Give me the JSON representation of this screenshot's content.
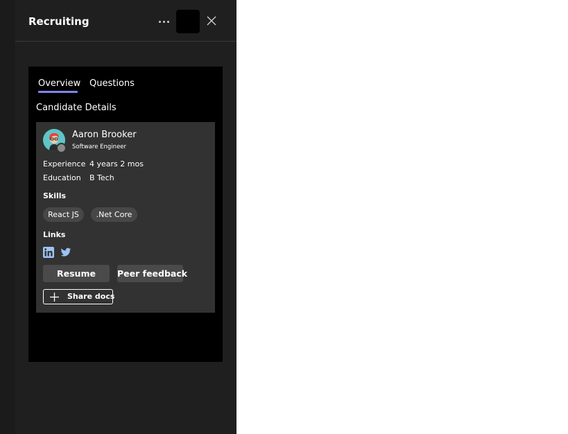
{
  "header": {
    "title": "Recruiting",
    "more_icon": "more-horizontal-icon",
    "close_icon": "close-icon"
  },
  "tabs": [
    {
      "label": "Overview",
      "selected": true
    },
    {
      "label": "Questions",
      "selected": false
    }
  ],
  "section_title": "Candidate Details",
  "candidate": {
    "name": "Aaron Brooker",
    "role": "Software Engineer",
    "presence": "offline",
    "details": [
      {
        "label": "Experience",
        "value": "4 years 2 mos"
      },
      {
        "label": "Education",
        "value": "B Tech"
      }
    ],
    "skills_heading": "Skills",
    "skills": [
      "React JS",
      ".Net Core"
    ],
    "links_heading": "Links",
    "links": [
      {
        "icon": "linkedin-icon"
      },
      {
        "icon": "twitter-icon"
      }
    ],
    "buttons": {
      "resume": "Resume",
      "peer_feedback": "Peer feedback",
      "share_docs": "Share docs"
    }
  },
  "colors": {
    "panel_bg": "#1f1f1f",
    "card_bg": "#323232",
    "accent": "#7f85f5",
    "icon_blue": "#9bc3f2"
  }
}
